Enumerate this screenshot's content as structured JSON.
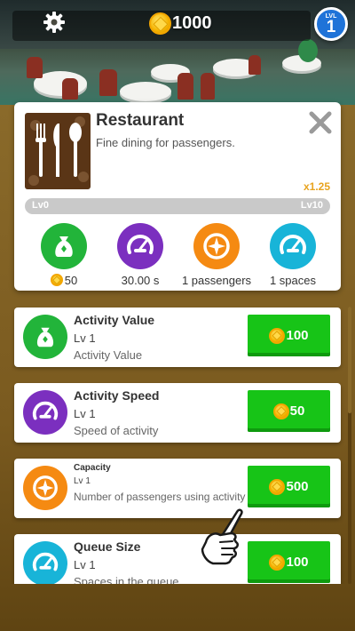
{
  "hud": {
    "coins": "1000",
    "level_label": "LVL",
    "level": "1",
    "icons": {
      "settings": "gear-icon",
      "coin": "coin-icon"
    }
  },
  "card": {
    "title": "Restaurant",
    "description": "Fine dining for passengers.",
    "multiplier": "x1.25",
    "level_min": "Lv0",
    "level_max": "Lv10",
    "level_progress": 0,
    "stats": [
      {
        "id": "value",
        "icon": "money-bag-icon",
        "value": "50",
        "has_coin": true,
        "color": "#22b43a"
      },
      {
        "id": "speed",
        "icon": "speedometer-icon",
        "value": "30.00 s",
        "has_coin": false,
        "color": "#7b2fbf"
      },
      {
        "id": "capacity",
        "icon": "compass-icon",
        "value": "1 passengers",
        "has_coin": false,
        "color": "#f58a12"
      },
      {
        "id": "queue",
        "icon": "gauge-icon",
        "value": "1 spaces",
        "has_coin": false,
        "color": "#18b4d8"
      }
    ]
  },
  "upgrades": [
    {
      "name": "Activity Value",
      "level": "Lv 1",
      "description": "Activity Value",
      "cost": "100",
      "icon": "money-bag-icon",
      "color": "#22b43a"
    },
    {
      "name": "Activity Speed",
      "level": "Lv 1",
      "description": "Speed of activity",
      "cost": "50",
      "icon": "speedometer-icon",
      "color": "#7b2fbf"
    },
    {
      "name": "Capacity",
      "level": "Lv 1",
      "description": "Number of passengers using activity",
      "cost": "500",
      "icon": "compass-icon",
      "color": "#f58a12"
    },
    {
      "name": "Queue Size",
      "level": "Lv 1",
      "description": "Spaces in the queue",
      "cost": "100",
      "icon": "gauge-icon",
      "color": "#18b4d8"
    }
  ],
  "colors": {
    "buy_button": "#17c417",
    "multiplier": "#e8a31e",
    "level_badge": "#1f73d8"
  }
}
